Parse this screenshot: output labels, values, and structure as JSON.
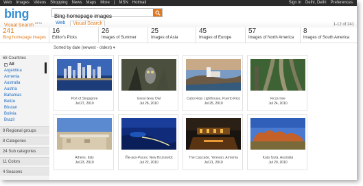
{
  "topnav": {
    "left": [
      "Web",
      "Images",
      "Videos",
      "Shopping",
      "News",
      "Maps",
      "More",
      "|",
      "MSN",
      "Hotmail"
    ],
    "right": [
      "Sign in",
      "Delhi, Delhi",
      "Preferences"
    ]
  },
  "brand": {
    "logo": "bing",
    "subtitle": "Visual Search",
    "beta": "BETA"
  },
  "search": {
    "value": "Bing homepage images"
  },
  "tabs": [
    {
      "label": "Web",
      "active": false
    },
    {
      "label": "Visual Search",
      "active": true
    }
  ],
  "page_count": "1-12 of 241",
  "categories": [
    {
      "count": "241",
      "label": "Bing homepage images",
      "active": true
    },
    {
      "count": "16",
      "label": "Editor's Picks",
      "active": false
    },
    {
      "count": "26",
      "label": "Images of Summer",
      "active": false
    },
    {
      "count": "25",
      "label": "Images of Asia",
      "active": false
    },
    {
      "count": "45",
      "label": "Images of Europe",
      "active": false
    },
    {
      "count": "57",
      "label": "Images of North America",
      "active": false
    },
    {
      "count": "8",
      "label": "Images of South America",
      "active": false
    }
  ],
  "sort_label": "Sorted by date (newest - oldest) ▾",
  "sidebar": {
    "header": "68 Countries",
    "countries": [
      {
        "label": "All",
        "selected": true
      },
      {
        "label": "Argentina",
        "selected": false
      },
      {
        "label": "Armenia",
        "selected": false
      },
      {
        "label": "Australia",
        "selected": false
      },
      {
        "label": "Austria",
        "selected": false
      },
      {
        "label": "Bahamas",
        "selected": false
      },
      {
        "label": "Belize",
        "selected": false
      },
      {
        "label": "Bhutan",
        "selected": false
      },
      {
        "label": "Bolivia",
        "selected": false
      },
      {
        "label": "Brazil",
        "selected": false
      }
    ],
    "groups": [
      "9 Regional groups",
      "8 Categories",
      "24 Sub categories",
      "11 Colors",
      "4 Seasons"
    ]
  },
  "images": [
    {
      "title": "Port of Singapore",
      "date": "Jul 27, 2010"
    },
    {
      "title": "Great Grey Owl",
      "date": "Jul 26, 2010"
    },
    {
      "title": "Cabo Rojo Lighthouse, Puerto Rico",
      "date": "Jul 25, 2010"
    },
    {
      "title": "Ficus tree",
      "date": "Jul 24, 2010"
    },
    {
      "title": "Athens, Italy",
      "date": "Jul 23, 2010"
    },
    {
      "title": "l'Île-aux-Puces, New Brunswick",
      "date": "Jul 22, 2010"
    },
    {
      "title": "The Cascade, Yerevan, Armenia",
      "date": "Jul 21, 2010"
    },
    {
      "title": "Kata Tjuta, Australia",
      "date": "Jul 20, 2010"
    }
  ],
  "colors": {
    "accent": "#e07b1c",
    "link": "#1a6bc2",
    "logo": "#3b8fd0",
    "topbar": "#2b2b2b"
  }
}
